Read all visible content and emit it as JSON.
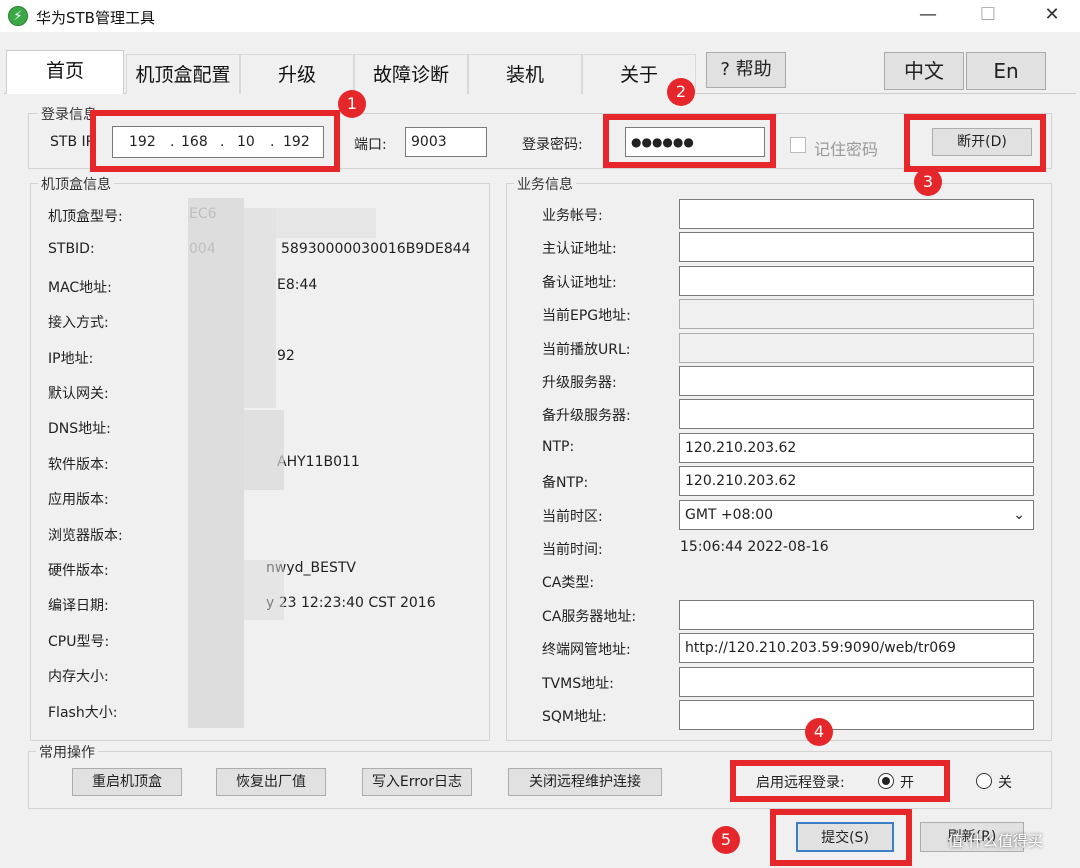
{
  "window": {
    "title": "华为STB管理工具",
    "icon_glyph": "⚡",
    "minimize": "—",
    "maximize": "☐",
    "close": "✕"
  },
  "tabs": [
    {
      "label": "首页",
      "active": true
    },
    {
      "label": "机顶盒配置"
    },
    {
      "label": "升级"
    },
    {
      "label": "故障诊断"
    },
    {
      "label": "装机"
    },
    {
      "label": "关于"
    }
  ],
  "help_label": "? 帮助",
  "lang": {
    "zh": "中文",
    "en": "En"
  },
  "login": {
    "group_title": "登录信息",
    "stb_ip_label": "STB IP",
    "ip": [
      "192",
      "168",
      "10",
      "192"
    ],
    "ip_dot": ".",
    "port_label": "端口:",
    "port_value": "9003",
    "password_label": "登录密码:",
    "password_value": "●●●●●●",
    "remember_label": "记住密码",
    "remember_checked": false,
    "disconnect_label": "断开(D)"
  },
  "stb_info": {
    "group_title": "机顶盒信息",
    "rows": [
      {
        "label": "机顶盒型号:",
        "value": "EC6"
      },
      {
        "label": "STBID:",
        "value": "58930000030016B9DE844",
        "prefix": "004"
      },
      {
        "label": "MAC地址:",
        "value": "E8:44"
      },
      {
        "label": "接入方式:",
        "value": ""
      },
      {
        "label": "IP地址:",
        "value": "92"
      },
      {
        "label": "默认网关:",
        "value": ""
      },
      {
        "label": "DNS地址:",
        "value": ""
      },
      {
        "label": "软件版本:",
        "value": "AHY11B011"
      },
      {
        "label": "应用版本:",
        "value": ""
      },
      {
        "label": "浏览器版本:",
        "value": ""
      },
      {
        "label": "硬件版本:",
        "value": "nwyd_BESTV"
      },
      {
        "label": "编译日期:",
        "value": "y 23 12:23:40 CST 2016"
      },
      {
        "label": "CPU型号:",
        "value": ""
      },
      {
        "label": "内存大小:",
        "value": ""
      },
      {
        "label": "Flash大小:",
        "value": ""
      }
    ]
  },
  "biz_info": {
    "group_title": "业务信息",
    "rows": [
      {
        "label": "业务帐号:",
        "value": "",
        "kind": "input"
      },
      {
        "label": "主认证地址:",
        "value": "",
        "kind": "input"
      },
      {
        "label": "备认证地址:",
        "value": "",
        "kind": "input"
      },
      {
        "label": "当前EPG地址:",
        "value": "",
        "kind": "gray"
      },
      {
        "label": "当前播放URL:",
        "value": "",
        "kind": "gray"
      },
      {
        "label": "升级服务器:",
        "value": "",
        "kind": "input"
      },
      {
        "label": "备升级服务器:",
        "value": "",
        "kind": "input"
      },
      {
        "label": "NTP:",
        "value": "120.210.203.62",
        "kind": "input"
      },
      {
        "label": "备NTP:",
        "value": "120.210.203.62",
        "kind": "input"
      },
      {
        "label": "当前时区:",
        "value": "GMT +08:00",
        "kind": "select"
      },
      {
        "label": "当前时间:",
        "value": "15:06:44 2022-08-16",
        "kind": "text"
      },
      {
        "label": "CA类型:",
        "value": "",
        "kind": "text"
      },
      {
        "label": "CA服务器地址:",
        "value": "",
        "kind": "input"
      },
      {
        "label": "终端网管地址:",
        "value": "http://120.210.203.59:9090/web/tr069",
        "kind": "input"
      },
      {
        "label": "TVMS地址:",
        "value": "",
        "kind": "input"
      },
      {
        "label": "SQM地址:",
        "value": "",
        "kind": "input"
      }
    ]
  },
  "common_ops": {
    "group_title": "常用操作",
    "buttons": [
      "重启机顶盒",
      "恢复出厂值",
      "写入Error日志",
      "关闭远程维护连接"
    ],
    "remote_label": "启用远程登录:",
    "remote_on": "开",
    "remote_off": "关",
    "remote_selected": "on"
  },
  "submit_label": "提交(S)",
  "refresh_label": "刷新(R)",
  "watermark": "值 什么值得买",
  "badges": [
    "1",
    "2",
    "3",
    "4",
    "5"
  ],
  "colors": {
    "highlight": "#e5262a",
    "window_bg": "#f0f0f0",
    "icon_green": "#3aa845"
  }
}
